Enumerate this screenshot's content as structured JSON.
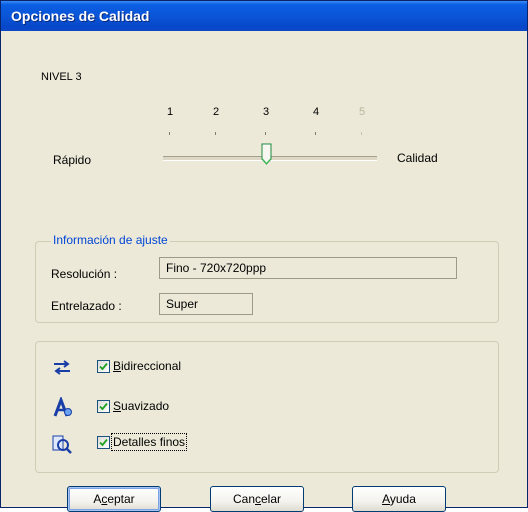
{
  "window": {
    "title": "Opciones de Calidad"
  },
  "level": {
    "label": "NIVEL 3"
  },
  "slider": {
    "ticks": [
      "1",
      "2",
      "3",
      "4",
      "5"
    ],
    "disabled_ticks": [
      "5"
    ],
    "value": 3,
    "min": 1,
    "max": 5,
    "left_label": "Rápido",
    "right_label": "Calidad"
  },
  "settings_info": {
    "legend": "Información de ajuste",
    "resolution_label": "Resolución :",
    "resolution_value": "Fino - 720x720ppp",
    "interlace_label": "Entrelazado :",
    "interlace_value": "Super"
  },
  "options": [
    {
      "label": "Bidireccional",
      "mnemonic": "B",
      "checked": true,
      "icon": "bidirectional-icon"
    },
    {
      "label": "Suavizado",
      "mnemonic": "S",
      "checked": true,
      "icon": "smoothing-icon"
    },
    {
      "label": "Detalles finos",
      "mnemonic": "",
      "checked": true,
      "icon": "fine-detail-icon"
    }
  ],
  "buttons": {
    "ok": {
      "pre": "A",
      "mn": "c",
      "post": "eptar"
    },
    "cancel": {
      "pre": "Can",
      "mn": "c",
      "post": "elar"
    },
    "help": {
      "pre": "",
      "mn": "A",
      "post": "yuda"
    }
  },
  "colors": {
    "accent": "#0046d5",
    "titlebar": "#0a53d6",
    "face": "#ece9d8"
  }
}
